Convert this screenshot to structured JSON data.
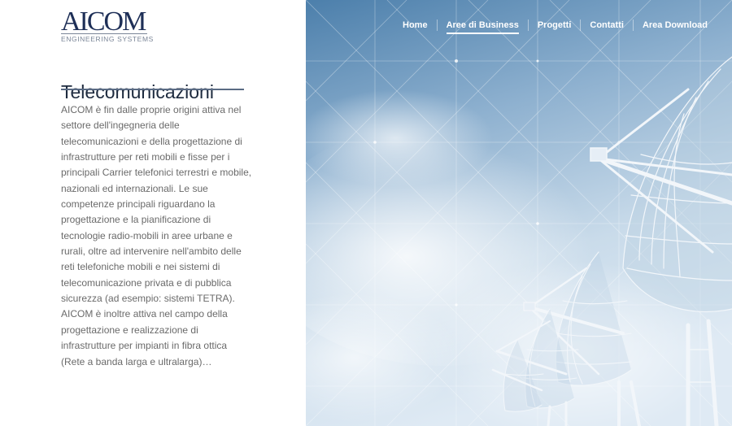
{
  "brand": {
    "logo_main": "AICOM",
    "logo_sub": "ENGINEERING SYSTEMS",
    "color": "#1e2f57"
  },
  "nav": {
    "items": [
      {
        "label": "Home",
        "active": false
      },
      {
        "label": "Aree di Business",
        "active": true
      },
      {
        "label": "Progetti",
        "active": false
      },
      {
        "label": "Contatti",
        "active": false
      },
      {
        "label": "Area Download",
        "active": false
      }
    ]
  },
  "content": {
    "title": "Telecomunicazioni",
    "body_lines": [
      "AICOM è fin dalle proprie origini attiva nel",
      "settore dell'ingegneria delle",
      "telecomunicazioni e della progettazione di",
      "infrastrutture per reti mobili e fisse per i",
      "principali Carrier telefonici terrestri e mobile,",
      "nazionali ed internazionali. Le sue",
      "competenze principali riguardano la",
      "progettazione e la pianificazione di",
      "tecnologie radio-mobili in aree urbane e",
      "rurali, oltre ad intervenire nell'ambito delle",
      "reti telefoniche mobili e nei sistemi di",
      "telecomunicazione privata e di pubblica",
      "sicurezza (ad esempio: sistemi TETRA).",
      "AICOM è inoltre attiva nel campo della",
      "progettazione e realizzazione di",
      "infrastrutture per impianti in fibra ottica",
      "(Rete a banda larga e ultralarga)…"
    ]
  },
  "colors": {
    "sky_top": "#4c7fab",
    "sky_bottom": "#dfeaf4",
    "text": "#6a6a6a",
    "title": "#1d2a3e"
  },
  "hero": {
    "icon": "satellite-dish-array"
  }
}
